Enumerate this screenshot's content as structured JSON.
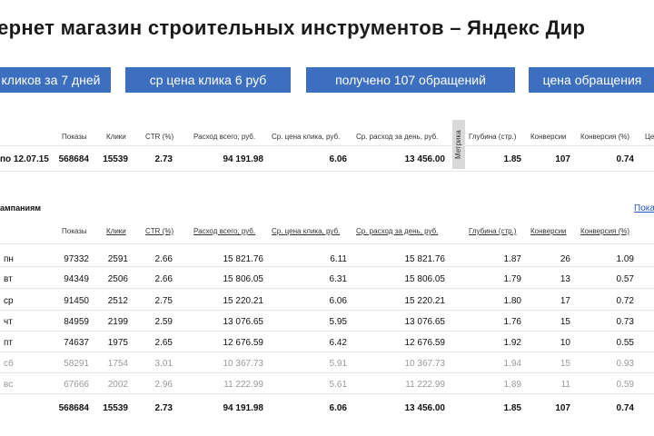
{
  "title": "тернет магазин строительных инструментов – Яндекс Дир",
  "pills": [
    "кликов за 7 дней",
    "ср цена клика 6 руб",
    "получено 107 обращений",
    "цена обращения"
  ],
  "summary": {
    "headers": [
      "Показы",
      "Клики",
      "CTR (%)",
      "Расход всего, руб.",
      "Ср. цена клика, руб.",
      "Ср. расход за день, руб.",
      "Глубина (стр.)",
      "Конверсии",
      "Конверсия (%)",
      "Це"
    ],
    "metrika_label": "Метрика",
    "row": {
      "label": "по 12.07.15",
      "values": [
        "568684",
        "15539",
        "2.73",
        "94 191.98",
        "6.06",
        "13 456.00",
        "1.85",
        "107",
        "0.74"
      ]
    }
  },
  "campaigns": {
    "section_label": "ампаниям",
    "link": "Пока",
    "headers": [
      "Показы",
      "Клики",
      "CTR (%)",
      "Расход всего, руб.",
      "Ср. цена клика, руб.",
      "Ср. расход за день, руб.",
      "Глубина (стр.)",
      "Конверсии",
      "Конверсия (%)"
    ],
    "rows": [
      {
        "label": "пн",
        "values": [
          "97332",
          "2591",
          "2.66",
          "15 821.76",
          "6.11",
          "15 821.76",
          "1.87",
          "26",
          "1.09"
        ]
      },
      {
        "label": "вт",
        "values": [
          "94349",
          "2506",
          "2.66",
          "15 806.05",
          "6.31",
          "15 806.05",
          "1.79",
          "13",
          "0.57"
        ]
      },
      {
        "label": "ср",
        "values": [
          "91450",
          "2512",
          "2.75",
          "15 220.21",
          "6.06",
          "15 220.21",
          "1.80",
          "17",
          "0.72"
        ]
      },
      {
        "label": "чт",
        "values": [
          "84959",
          "2199",
          "2.59",
          "13 076.65",
          "5.95",
          "13 076.65",
          "1.76",
          "15",
          "0.73"
        ]
      },
      {
        "label": "пт",
        "values": [
          "74637",
          "1975",
          "2.65",
          "12 676.59",
          "6.42",
          "12 676.59",
          "1.92",
          "10",
          "0.55"
        ]
      },
      {
        "label": "сб",
        "values": [
          "58291",
          "1754",
          "3.01",
          "10 367.73",
          "5.91",
          "10 367.73",
          "1.94",
          "15",
          "0.93"
        ],
        "weekend": true
      },
      {
        "label": "вс",
        "values": [
          "67666",
          "2002",
          "2.96",
          "11 222.99",
          "5.61",
          "11 222.99",
          "1.89",
          "11",
          "0.59"
        ],
        "weekend": true
      }
    ],
    "total": {
      "values": [
        "568684",
        "15539",
        "2.73",
        "94 191.98",
        "6.06",
        "13 456.00",
        "1.85",
        "107",
        "0.74"
      ]
    }
  }
}
